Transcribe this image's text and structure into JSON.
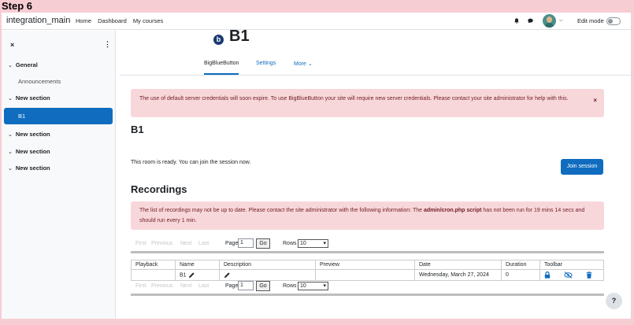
{
  "step_label": "Step 6",
  "navbar": {
    "brand": "integration_main",
    "links": [
      "Home",
      "Dashboard",
      "My courses"
    ],
    "edit_mode_label": "Edit mode"
  },
  "drawer": {
    "close_glyph": "×",
    "more_glyph": "⋮",
    "items": [
      {
        "label": "General"
      },
      {
        "label": "Announcements"
      },
      {
        "label": "New section"
      },
      {
        "label": "B1"
      },
      {
        "label": "New section"
      },
      {
        "label": "New section"
      },
      {
        "label": "New section"
      }
    ]
  },
  "page": {
    "title": "B1",
    "icon_letter": "b",
    "tabs": [
      "BigBlueButton",
      "Settings",
      "More"
    ],
    "credentials_alert": "The use of default server credentials will soon expire. To use BigBlueButton your site will require new server credentials. Please contact your site administrator for help with this.",
    "alert_close": "×",
    "room_heading": "B1",
    "room_status": "This room is ready. You can join the session now.",
    "join_button": "Join session",
    "recordings_heading": "Recordings",
    "recordings_alert_pre": "The list of recordings may not be up to date. Please contact the site administrator with the following information: The ",
    "recordings_alert_bold": "admin/cron.php script",
    "recordings_alert_post": " has not been run for 19 mins 14 secs and should run every 1 min.",
    "help_glyph": "?"
  },
  "pager": {
    "first": "First",
    "previous": "Previous",
    "next": "Next",
    "last": "Last",
    "page_label": "Page",
    "page_value": "1",
    "go": "Go",
    "rows_label": "Rows",
    "rows_value": "10"
  },
  "table": {
    "headers": [
      "Playback",
      "Name",
      "Description",
      "Preview",
      "Date",
      "Duration",
      "Toolbar"
    ],
    "row": {
      "playback": "",
      "name": "B1",
      "description": "",
      "preview": "",
      "date": "Wednesday, March 27, 2024",
      "duration": "0"
    }
  },
  "colors": {
    "accent": "#0f6cbf",
    "alert_bg": "#f8d7da",
    "alert_text": "#6e1d26",
    "page_border": "#f6cdd3"
  }
}
